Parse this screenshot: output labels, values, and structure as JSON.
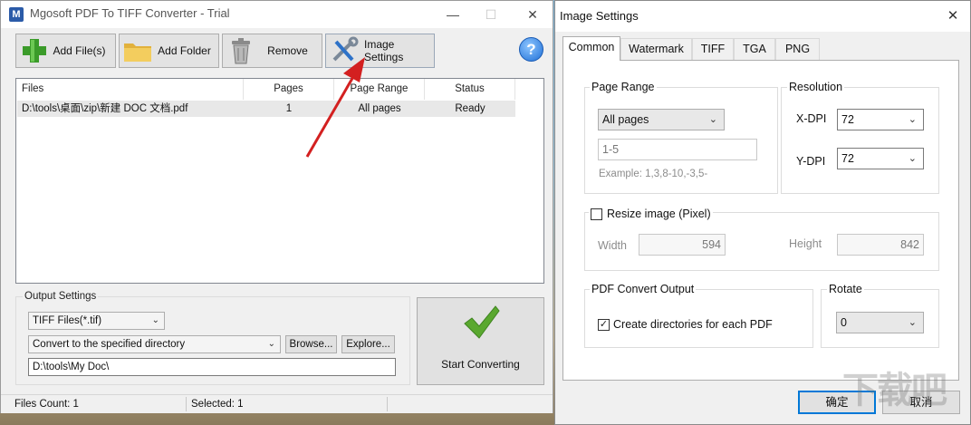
{
  "main_window": {
    "title": "Mgosoft PDF To TIFF Converter - Trial",
    "app_icon_letter": "M",
    "caption": {
      "minimize": "—",
      "maximize": "☐",
      "close": "✕"
    },
    "toolbar": {
      "add_files": "Add File(s)",
      "add_folder": "Add Folder",
      "remove": "Remove",
      "image_settings": "Image Settings",
      "help": "?"
    },
    "table": {
      "columns": [
        "Files",
        "Pages",
        "Page Range",
        "Status"
      ],
      "rows": [
        {
          "file": "D:\\tools\\桌面\\zip\\新建 DOC 文档.pdf",
          "pages": "1",
          "page_range": "All pages",
          "status": "Ready"
        }
      ]
    },
    "output": {
      "legend": "Output Settings",
      "format": "TIFF Files(*.tif)",
      "dir_mode": "Convert to the specified directory",
      "browse": "Browse...",
      "explore": "Explore...",
      "path": "D:\\tools\\My Doc\\"
    },
    "start_label": "Start Converting",
    "status_bar": {
      "files_count": "Files Count: 1",
      "selected": "Selected: 1"
    }
  },
  "dialog": {
    "title": "Image Settings",
    "close": "✕",
    "tabs": [
      "Common",
      "Watermark",
      "TIFF",
      "TGA",
      "PNG"
    ],
    "page_range": {
      "legend": "Page Range",
      "mode": "All pages",
      "value": "1-5",
      "example": "Example: 1,3,8-10,-3,5-"
    },
    "resolution": {
      "legend": "Resolution",
      "xdpi_label": "X-DPI",
      "xdpi": "72",
      "ydpi_label": "Y-DPI",
      "ydpi": "72"
    },
    "resize": {
      "label": "Resize image (Pixel)",
      "checked": false,
      "width_label": "Width",
      "width": "594",
      "height_label": "Height",
      "height": "842"
    },
    "pdf_output": {
      "legend": "PDF Convert Output",
      "create_dirs": "Create directories for each PDF",
      "checked": true
    },
    "rotate": {
      "legend": "Rotate",
      "value": "0"
    },
    "ok": "确定",
    "cancel": "取消"
  },
  "watermark_text": "下载吧"
}
